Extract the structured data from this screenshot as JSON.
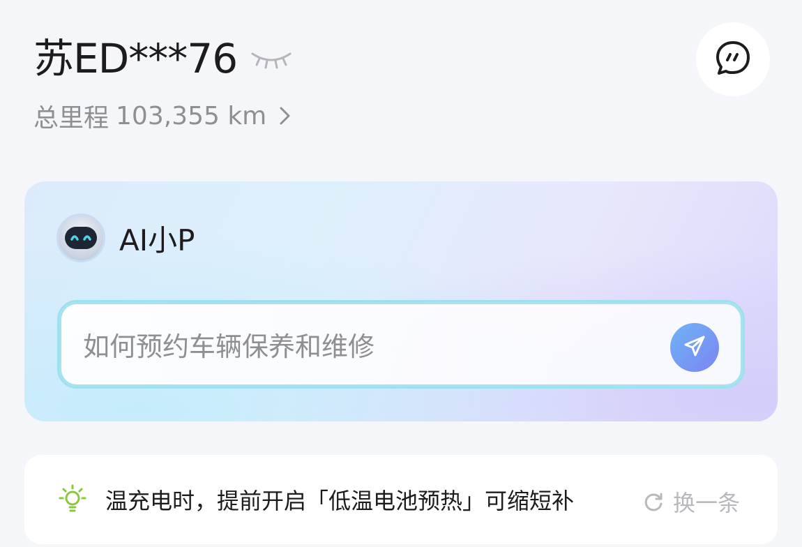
{
  "vehicle": {
    "plate": "苏ED***76",
    "mileage_label": "总里程",
    "mileage_value": "103,355 km"
  },
  "ai_assistant": {
    "name": "AI小P",
    "input_placeholder": "如何预约车辆保养和维修"
  },
  "tip": {
    "text": "温充电时，提前开启「低温电池预热」可缩短补",
    "refresh_label": "换一条"
  },
  "icons": {
    "hide_plate": "eye-closed-icon",
    "mileage_detail": "chevron-right-icon",
    "chat": "chat-bubble-icon",
    "send": "paper-plane-icon",
    "tip": "lightbulb-icon",
    "refresh": "refresh-icon",
    "avatar": "robot-avatar-icon"
  },
  "colors": {
    "accent_send": "#7c85f2",
    "tip_bulb": "#8cc63f",
    "avatar_eyes": "#4fd1e6"
  }
}
